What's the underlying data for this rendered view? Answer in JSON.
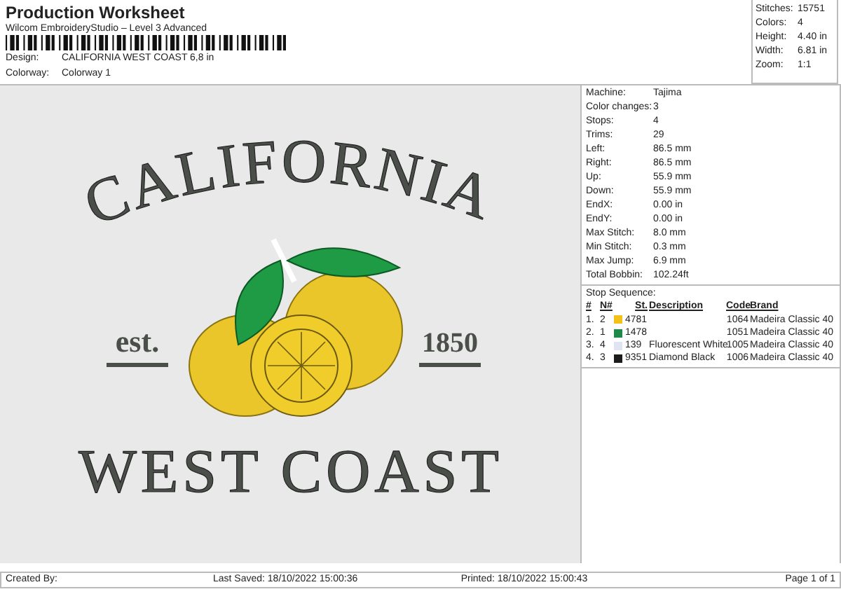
{
  "header": {
    "title": "Production Worksheet",
    "subtitle": "Wilcom EmbroideryStudio – Level 3 Advanced",
    "fields": [
      {
        "label": "Design:",
        "value": "CALIFORNIA WEST COAST 6,8 in"
      },
      {
        "label": "Colorway:",
        "value": "Colorway 1"
      }
    ]
  },
  "summary": [
    {
      "label": "Stitches:",
      "value": "15751"
    },
    {
      "label": "Colors:",
      "value": "4"
    },
    {
      "label": "Height:",
      "value": "4.40 in"
    },
    {
      "label": "Width:",
      "value": "6.81 in"
    },
    {
      "label": "Zoom:",
      "value": "1:1"
    }
  ],
  "design_preview": {
    "arc_text": "CALIFORNIA",
    "left_text": "est.",
    "right_text": "1850",
    "bottom_text": "WEST COAST"
  },
  "details": [
    {
      "label": "Machine:",
      "value": "Tajima"
    },
    {
      "label": "Color changes:",
      "value": "3"
    },
    {
      "label": "Stops:",
      "value": "4"
    },
    {
      "label": "Trims:",
      "value": "29"
    },
    {
      "label": "Left:",
      "value": "86.5 mm"
    },
    {
      "label": "Right:",
      "value": "86.5 mm"
    },
    {
      "label": "Up:",
      "value": "55.9 mm"
    },
    {
      "label": "Down:",
      "value": "55.9 mm"
    },
    {
      "label": "EndX:",
      "value": "0.00 in"
    },
    {
      "label": "EndY:",
      "value": "0.00 in"
    },
    {
      "label": "Max Stitch:",
      "value": "8.0 mm"
    },
    {
      "label": "Min Stitch:",
      "value": "0.3 mm"
    },
    {
      "label": "Max Jump:",
      "value": "6.9 mm"
    },
    {
      "label": "Total Bobbin:",
      "value": "102.24ft"
    }
  ],
  "stop_sequence": {
    "title": "Stop Sequence:",
    "columns": [
      "#",
      "N#",
      "St.",
      "Description",
      "Code",
      "Brand"
    ],
    "rows": [
      {
        "index": "1.",
        "needle": "2",
        "color": "#f2c21b",
        "stitches": "4781",
        "description": "",
        "code": "1064",
        "brand": "Madeira Classic 40"
      },
      {
        "index": "2.",
        "needle": "1",
        "color": "#1e8a4a",
        "stitches": "1478",
        "description": "",
        "code": "1051",
        "brand": "Madeira Classic 40"
      },
      {
        "index": "3.",
        "needle": "4",
        "color": "#dfe3f2",
        "stitches": "139",
        "description": "Fluorescent White",
        "code": "1005",
        "brand": "Madeira Classic 40"
      },
      {
        "index": "4.",
        "needle": "3",
        "color": "#1c1c1c",
        "stitches": "9351",
        "description": "Diamond Black",
        "code": "1006",
        "brand": "Madeira Classic 40"
      }
    ]
  },
  "footer": {
    "created_by": "Created By:",
    "last_saved": "Last Saved: 18/10/2022 15:00:36",
    "printed": "Printed: 18/10/2022 15:00:43",
    "page": "Page 1 of 1"
  }
}
